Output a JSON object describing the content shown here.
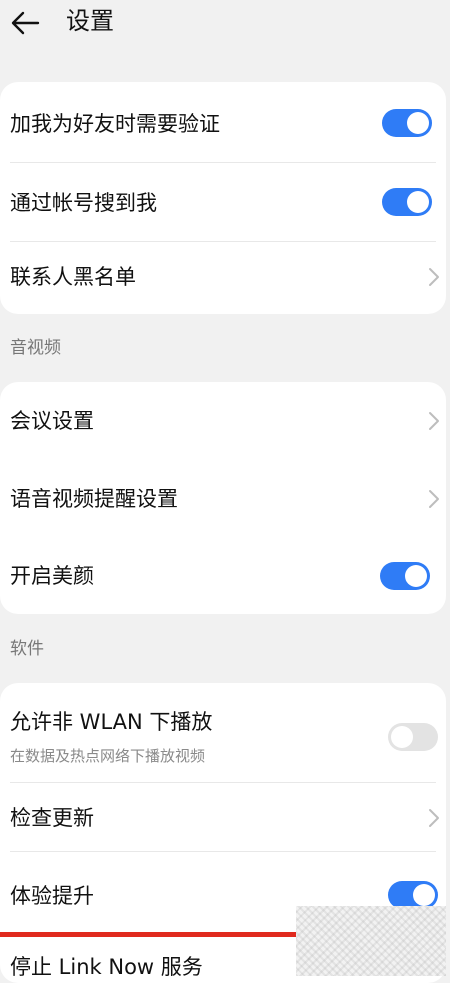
{
  "header": {
    "title": "设置"
  },
  "card_privacy": {
    "items": [
      {
        "label": "加我为好友时需要验证",
        "toggle": true
      },
      {
        "label": "通过帐号搜到我",
        "toggle": true
      },
      {
        "label": "联系人黑名单"
      }
    ]
  },
  "section_av": {
    "label": "音视频",
    "items": [
      {
        "label": "会议设置"
      },
      {
        "label": "语音视频提醒设置"
      },
      {
        "label": "开启美颜",
        "toggle": true
      }
    ]
  },
  "section_software": {
    "label": "软件",
    "items": [
      {
        "label": "允许非 WLAN 下播放",
        "sublabel": "在数据及热点网络下播放视频",
        "toggle": false
      },
      {
        "label": "检查更新"
      },
      {
        "label": "体验提升",
        "toggle": true
      },
      {
        "label": "停止 Link Now 服务"
      }
    ]
  },
  "colors": {
    "accent": "#2f7cf6",
    "background": "#f1f1f1",
    "highlight": "#e02a1e"
  },
  "icons": {
    "back": "arrow-left-icon",
    "chevron": "chevron-right-icon"
  }
}
